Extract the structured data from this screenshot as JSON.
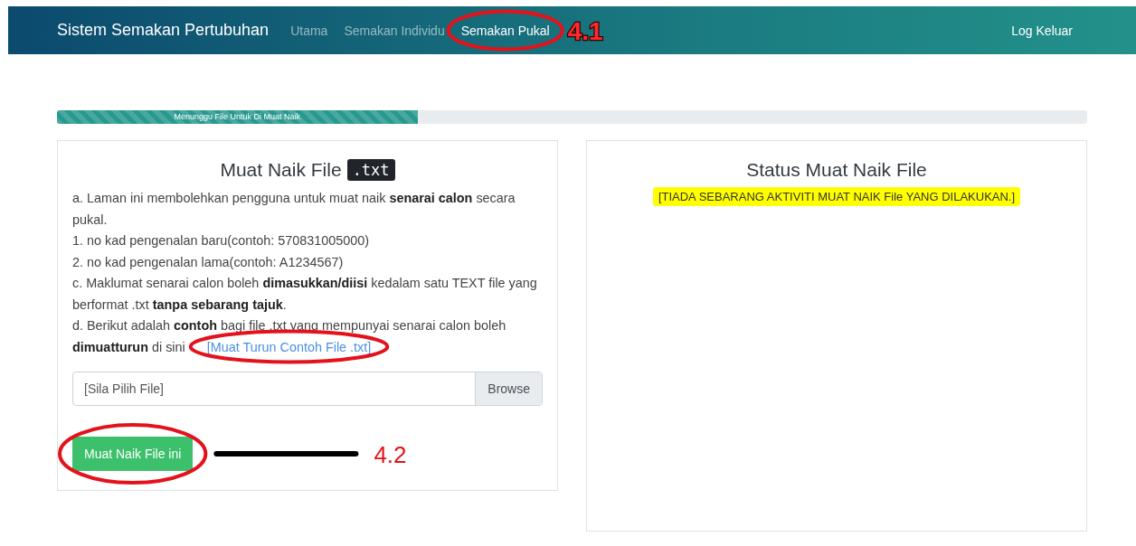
{
  "navbar": {
    "brand": "Sistem Semakan Pertubuhan",
    "items": [
      {
        "label": "Utama",
        "selected": false,
        "circled": false
      },
      {
        "label": "Semakan Individu",
        "selected": false,
        "circled": false
      },
      {
        "label": "Semakan Pukal",
        "selected": true,
        "circled": true,
        "callout": "4.1"
      }
    ],
    "logout": "Log Keluar"
  },
  "progress": {
    "label": "Menunggu File Untuk Di Muat Naik",
    "level": 0.35
  },
  "upload_card": {
    "title": "Muat Naik File",
    "title_badge": ".txt",
    "notes": [
      {
        "text": "a. Laman ini membolehkan pengguna untuk muat naik **senarai calon** secara pukal."
      },
      {
        "text": "1. no kad pengenalan baru(contoh: 570831005000)"
      },
      {
        "text": "2. no kad pengenalan lama(contoh: A1234567)"
      },
      {
        "text": "c. Maklumat senarai calon boleh **dimasukkan/diisi** kedalam satu TEXT file yang berformat .txt **tanpa sebarang tajuk**."
      },
      {
        "text": "d. Berikut adalah **contoh** bagi file .txt yang mempunyai senarai calon boleh **dimuatturun** di sini",
        "link": "[Muat Turun Contoh File .txt]",
        "link_circled": true
      }
    ],
    "file_field": {
      "placeholder": "[Sila Pilih File]",
      "browse": "Browse"
    },
    "submit": {
      "label": "Muat Naik File ini",
      "circled": true,
      "callout": "4.2"
    }
  },
  "status_card": {
    "title": "Status Muat Naik File",
    "message": "[TIADA SEBARANG AKTIVITI MUAT NAIK File YANG DILAKUKAN.]"
  }
}
